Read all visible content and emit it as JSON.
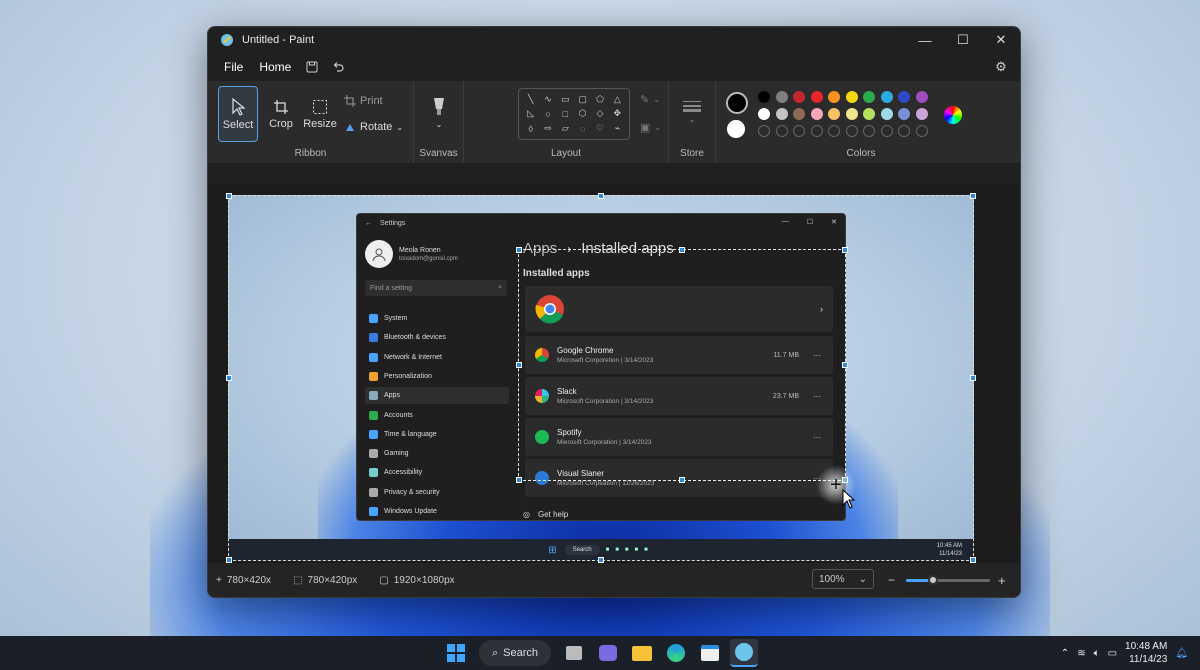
{
  "window": {
    "title": "Untitled - Paint"
  },
  "menu": {
    "file": "File",
    "home": "Home"
  },
  "ribbon": {
    "select": "Select",
    "crop": "Crop",
    "resize": "Resize",
    "print": "Print",
    "rotate": "Rotate",
    "group_ribbon": "Ribbon",
    "group_svanvas": "Svanvas",
    "group_layout": "Layout",
    "group_store": "Store",
    "group_colors": "Colors"
  },
  "colors": {
    "row1": [
      "#000000",
      "#7f7f7f",
      "#c1272d",
      "#e8242b",
      "#f7931e",
      "#f5d90a",
      "#2cab4a",
      "#29abe2",
      "#2e49c4",
      "#a04bc2"
    ],
    "row2": [
      "#ffffff",
      "#c3c3c3",
      "#8c6a55",
      "#f4a7b9",
      "#f7c163",
      "#efe58a",
      "#b5e061",
      "#9fd9e8",
      "#7b8fd6",
      "#c9a6d8"
    ]
  },
  "statusbar": {
    "cursor": "780×420x",
    "selection": "780×420px",
    "canvas": "1920×1080px",
    "zoom": "100%"
  },
  "settings": {
    "title": "Settings",
    "user_name": "Meola Ronen",
    "user_email": "tossidom@gonsil.cpm",
    "search_placeholder": "Find a setting",
    "nav": [
      "System",
      "Bluetooth & devices",
      "Network & Internet",
      "Personalization",
      "Apps",
      "Accounts",
      "Time & language",
      "Gaming",
      "Accessibility",
      "Privacy & security",
      "Windows Update"
    ],
    "breadcrumb_parent": "Apps",
    "breadcrumb_sep": "›",
    "breadcrumb_current": "Installed apps",
    "section": "Installed apps",
    "apps": [
      {
        "name": "Google Chrome",
        "publisher": "Microseft Corporetion  |  3/14/2023",
        "size": "11.7 MB"
      },
      {
        "name": "Slack",
        "publisher": "Microsoft Corporation  |  3/14/2023",
        "size": "23.7 MB"
      },
      {
        "name": "Spotify",
        "publisher": "Mierosift Corporation  |  3/14/2023",
        "size": ""
      },
      {
        "name": "Visual Slaner",
        "publisher": "Microsoft Corpeation  |  11/26/2023",
        "size": ""
      }
    ],
    "get_help": "Get help",
    "inner_search": "Search",
    "inner_time": "10:45 AM",
    "inner_date": "11/14/23"
  },
  "taskbar": {
    "search": "Search",
    "time": "10:48 AM",
    "date": "11/14/23"
  }
}
